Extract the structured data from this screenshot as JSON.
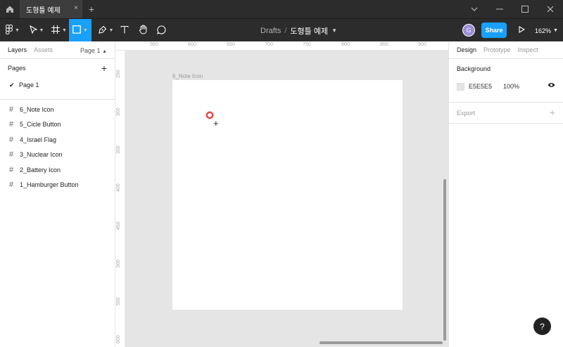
{
  "titlebar": {
    "tab_title": "도형틀 예제",
    "close_glyph": "×",
    "new_tab_glyph": "+"
  },
  "toolbar": {
    "breadcrumb_root": "Drafts",
    "breadcrumb_sep": "/",
    "file_name": "도형틀 예제",
    "avatar_initial": "G",
    "share_label": "Share",
    "zoom_label": "162%"
  },
  "left_panel": {
    "tabs": [
      "Layers",
      "Assets"
    ],
    "page_selector": "Page 1",
    "pages_heading": "Pages",
    "pages": [
      "Page 1"
    ],
    "layers": [
      "6_Note Icon",
      "5_Cicle Button",
      "4_Israel Flag",
      "3_Nuclear Icon",
      "2_Battery Icon",
      "1_Hamburger Button"
    ]
  },
  "rulers": {
    "horizontal": [
      "550",
      "600",
      "650",
      "700",
      "750",
      "800",
      "850",
      "900"
    ],
    "vertical": [
      "250",
      "300",
      "350",
      "400",
      "450",
      "500",
      "550",
      "600"
    ]
  },
  "canvas": {
    "frame_label": "6_Note Icon"
  },
  "right_panel": {
    "tabs": [
      "Design",
      "Prototype",
      "Inspect"
    ],
    "background_heading": "Background",
    "background_hex": "E5E5E5",
    "background_opacity": "100%",
    "export_heading": "Export"
  },
  "help_label": "?",
  "colors": {
    "accent": "#18a0fb",
    "dark_chrome": "#2c2c2c",
    "canvas_bg": "#e5e5e5"
  }
}
